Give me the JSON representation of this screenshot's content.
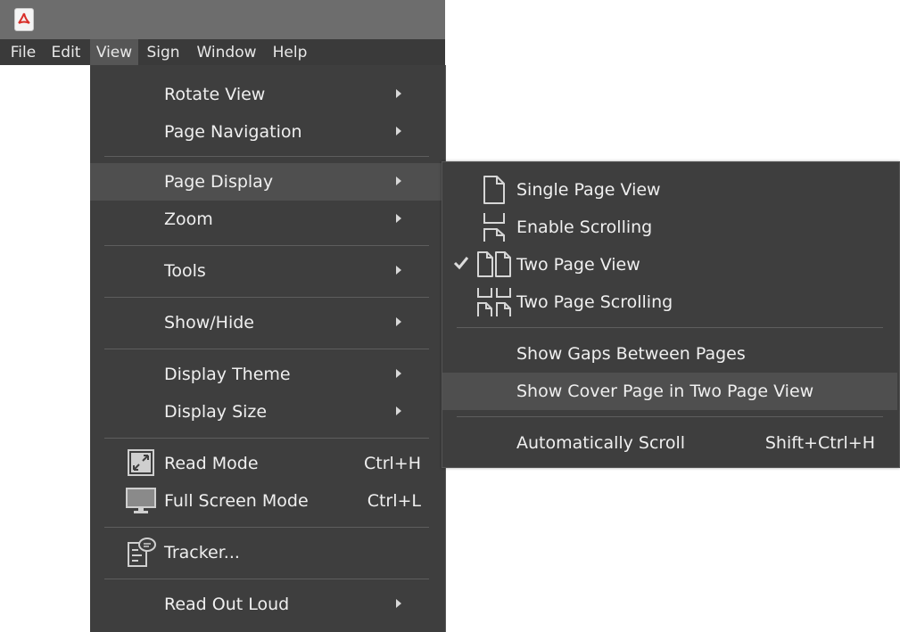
{
  "menubar": {
    "items": [
      "File",
      "Edit",
      "View",
      "Sign",
      "Window",
      "Help"
    ],
    "active": "View"
  },
  "view_menu": {
    "items": [
      {
        "label": "Rotate View",
        "submenu": true
      },
      {
        "label": "Page Navigation",
        "submenu": true
      },
      {
        "label": "Page Display",
        "submenu": true,
        "highlighted": true
      },
      {
        "label": "Zoom",
        "submenu": true
      },
      {
        "label": "Tools",
        "submenu": true
      },
      {
        "label": "Show/Hide",
        "submenu": true
      },
      {
        "label": "Display Theme",
        "submenu": true
      },
      {
        "label": "Display Size",
        "submenu": true
      },
      {
        "label": "Read Mode",
        "shortcut": "Ctrl+H",
        "icon": "read-mode-icon"
      },
      {
        "label": "Full Screen Mode",
        "shortcut": "Ctrl+L",
        "icon": "monitor-icon"
      },
      {
        "label": "Tracker...",
        "icon": "tracker-icon"
      },
      {
        "label": "Read Out Loud",
        "submenu": true
      }
    ]
  },
  "page_display_submenu": {
    "items": [
      {
        "label": "Single Page View",
        "icon": "single-page-icon"
      },
      {
        "label": "Enable Scrolling",
        "icon": "scrolling-icon"
      },
      {
        "label": "Two Page View",
        "icon": "two-page-icon",
        "checked": true
      },
      {
        "label": "Two Page Scrolling",
        "icon": "two-page-scrolling-icon"
      },
      {
        "label": "Show Gaps Between Pages"
      },
      {
        "label": "Show Cover Page in Two Page View",
        "highlighted": true
      },
      {
        "label": "Automatically Scroll",
        "shortcut": "Shift+Ctrl+H"
      }
    ]
  },
  "colors": {
    "menu_bg": "#3e3e3e",
    "menu_highlight": "#4f4f4f",
    "menubar_bg": "#3a3a3a",
    "titlebar_bg": "#6d6d6d",
    "app_icon_red": "#d9302a"
  }
}
